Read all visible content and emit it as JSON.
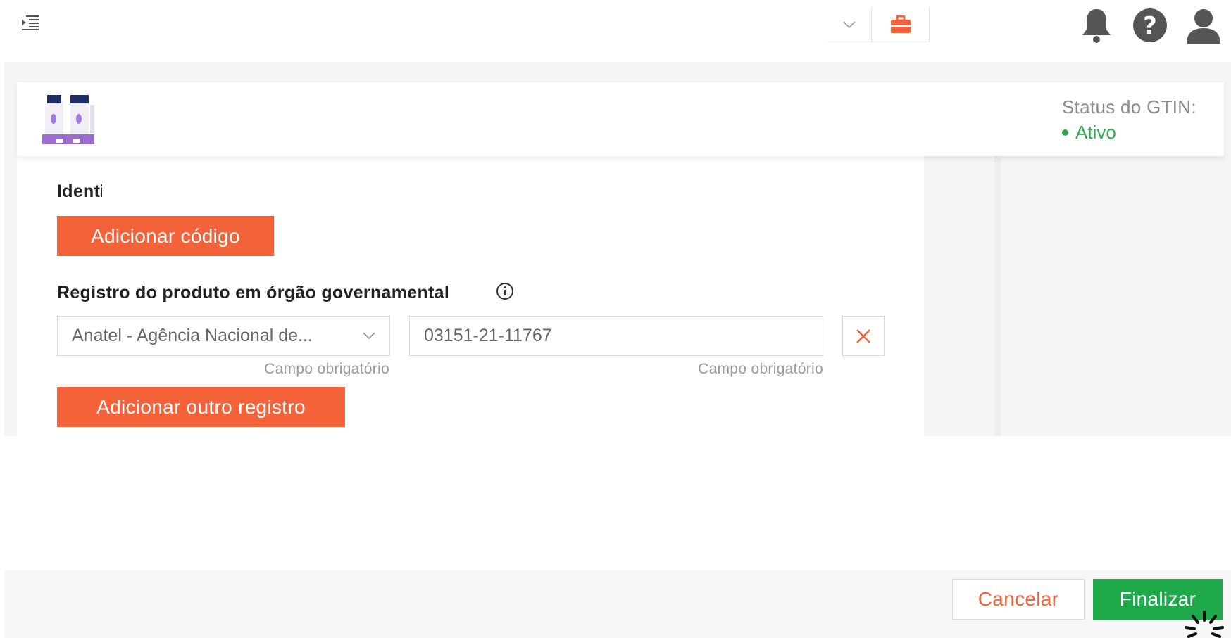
{
  "header": {
    "menu_icon": "menu-collapse-icon",
    "dropdown_icon": "chevron-down-icon",
    "briefcase_icon": "briefcase-icon",
    "notifications_icon": "bell-icon",
    "help_icon": "help-circle-icon",
    "user_icon": "user-icon"
  },
  "product": {
    "thumbnail_icon": "product-image",
    "gtin_status_label": "Status do GTIN:",
    "gtin_status_value": "Ativo"
  },
  "identification": {
    "title": "Identificação",
    "add_code_label": "Adicionar código"
  },
  "registro": {
    "title": "Registro do produto em órgão governamental",
    "info_icon": "info-icon",
    "agency_selected": "Anatel - Agência Nacional de...",
    "agency_hint": "Campo obrigatório",
    "registration_number": "03151-21-11767",
    "number_hint": "Campo obrigatório",
    "remove_icon": "close-icon",
    "add_another_label": "Adicionar outro registro"
  },
  "footer": {
    "cancel_label": "Cancelar",
    "finish_label": "Finalizar",
    "loading_icon": "spinner-icon"
  },
  "colors": {
    "accent_orange": "#f4623a",
    "success_green": "#1eaa4a",
    "status_green": "#2eaa4f"
  }
}
